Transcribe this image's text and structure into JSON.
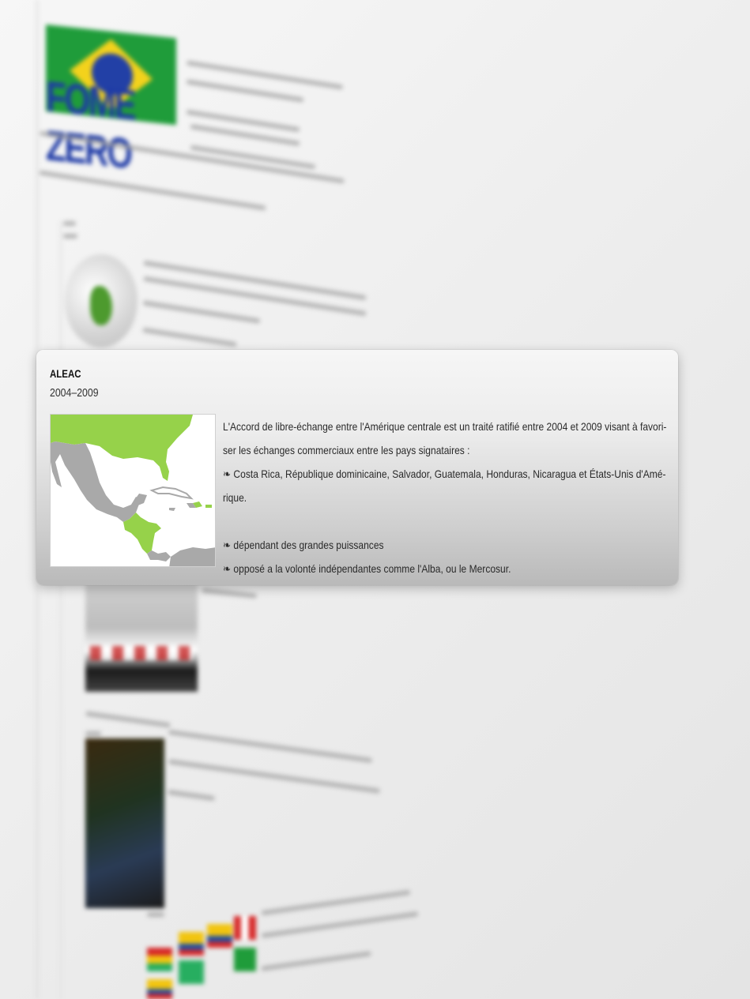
{
  "background": {
    "logo_text": "FOME ZERO"
  },
  "card": {
    "title": "ALEAC",
    "years": "2004–2009",
    "lines": [
      "L'Accord de libre-échange entre l'Amérique centrale est un traité ratifié entre 2004 et 2009 visant à favori-",
      "ser les échanges commerciaux entre les pays signataires :",
      "❧ Costa Rica, République dominicaine, Salvador, Guatemala, Honduras, Nicaragua et États-Unis d'Amé-",
      "rique."
    ],
    "bullets": [
      "❧ dépendant des grandes puissances",
      "❧ opposé a la volonté indépendantes comme l'Alba, ou le Mercosur."
    ]
  },
  "colors": {
    "member_green": "#96d24a",
    "other_land": "#a9a9a9",
    "sea": "#ffffff"
  }
}
